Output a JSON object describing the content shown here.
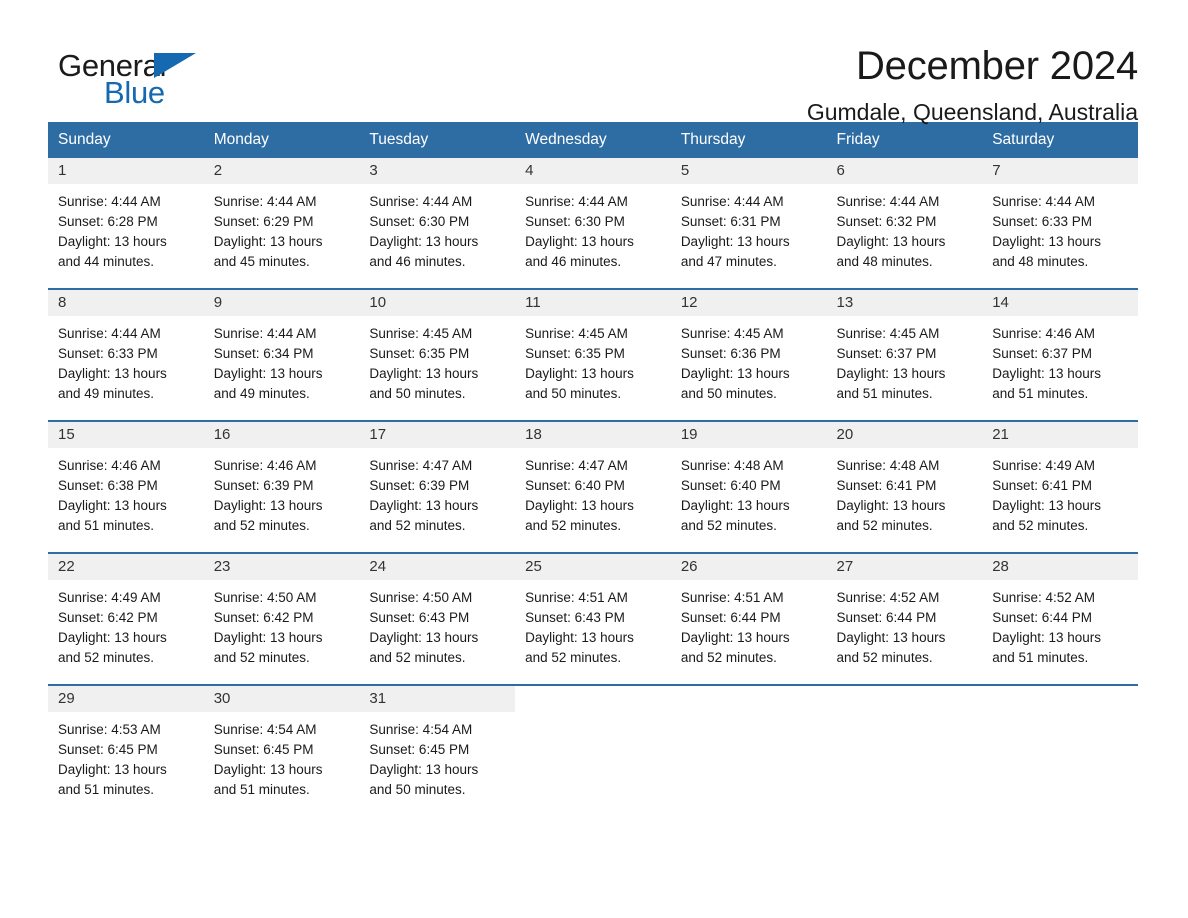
{
  "brand": {
    "name_part1": "General",
    "name_part2": "Blue",
    "accent_color": "#1569b0"
  },
  "header": {
    "title": "December 2024",
    "subtitle": "Gumdale, Queensland, Australia"
  },
  "theme": {
    "header_blue": "#2e6da4",
    "daynum_band": "#f0f0f0",
    "text": "#1a1a1a"
  },
  "calendar": {
    "weekdays": [
      "Sunday",
      "Monday",
      "Tuesday",
      "Wednesday",
      "Thursday",
      "Friday",
      "Saturday"
    ],
    "weeks": [
      [
        {
          "day": "1",
          "sunrise": "Sunrise: 4:44 AM",
          "sunset": "Sunset: 6:28 PM",
          "daylight1": "Daylight: 13 hours",
          "daylight2": "and 44 minutes."
        },
        {
          "day": "2",
          "sunrise": "Sunrise: 4:44 AM",
          "sunset": "Sunset: 6:29 PM",
          "daylight1": "Daylight: 13 hours",
          "daylight2": "and 45 minutes."
        },
        {
          "day": "3",
          "sunrise": "Sunrise: 4:44 AM",
          "sunset": "Sunset: 6:30 PM",
          "daylight1": "Daylight: 13 hours",
          "daylight2": "and 46 minutes."
        },
        {
          "day": "4",
          "sunrise": "Sunrise: 4:44 AM",
          "sunset": "Sunset: 6:30 PM",
          "daylight1": "Daylight: 13 hours",
          "daylight2": "and 46 minutes."
        },
        {
          "day": "5",
          "sunrise": "Sunrise: 4:44 AM",
          "sunset": "Sunset: 6:31 PM",
          "daylight1": "Daylight: 13 hours",
          "daylight2": "and 47 minutes."
        },
        {
          "day": "6",
          "sunrise": "Sunrise: 4:44 AM",
          "sunset": "Sunset: 6:32 PM",
          "daylight1": "Daylight: 13 hours",
          "daylight2": "and 48 minutes."
        },
        {
          "day": "7",
          "sunrise": "Sunrise: 4:44 AM",
          "sunset": "Sunset: 6:33 PM",
          "daylight1": "Daylight: 13 hours",
          "daylight2": "and 48 minutes."
        }
      ],
      [
        {
          "day": "8",
          "sunrise": "Sunrise: 4:44 AM",
          "sunset": "Sunset: 6:33 PM",
          "daylight1": "Daylight: 13 hours",
          "daylight2": "and 49 minutes."
        },
        {
          "day": "9",
          "sunrise": "Sunrise: 4:44 AM",
          "sunset": "Sunset: 6:34 PM",
          "daylight1": "Daylight: 13 hours",
          "daylight2": "and 49 minutes."
        },
        {
          "day": "10",
          "sunrise": "Sunrise: 4:45 AM",
          "sunset": "Sunset: 6:35 PM",
          "daylight1": "Daylight: 13 hours",
          "daylight2": "and 50 minutes."
        },
        {
          "day": "11",
          "sunrise": "Sunrise: 4:45 AM",
          "sunset": "Sunset: 6:35 PM",
          "daylight1": "Daylight: 13 hours",
          "daylight2": "and 50 minutes."
        },
        {
          "day": "12",
          "sunrise": "Sunrise: 4:45 AM",
          "sunset": "Sunset: 6:36 PM",
          "daylight1": "Daylight: 13 hours",
          "daylight2": "and 50 minutes."
        },
        {
          "day": "13",
          "sunrise": "Sunrise: 4:45 AM",
          "sunset": "Sunset: 6:37 PM",
          "daylight1": "Daylight: 13 hours",
          "daylight2": "and 51 minutes."
        },
        {
          "day": "14",
          "sunrise": "Sunrise: 4:46 AM",
          "sunset": "Sunset: 6:37 PM",
          "daylight1": "Daylight: 13 hours",
          "daylight2": "and 51 minutes."
        }
      ],
      [
        {
          "day": "15",
          "sunrise": "Sunrise: 4:46 AM",
          "sunset": "Sunset: 6:38 PM",
          "daylight1": "Daylight: 13 hours",
          "daylight2": "and 51 minutes."
        },
        {
          "day": "16",
          "sunrise": "Sunrise: 4:46 AM",
          "sunset": "Sunset: 6:39 PM",
          "daylight1": "Daylight: 13 hours",
          "daylight2": "and 52 minutes."
        },
        {
          "day": "17",
          "sunrise": "Sunrise: 4:47 AM",
          "sunset": "Sunset: 6:39 PM",
          "daylight1": "Daylight: 13 hours",
          "daylight2": "and 52 minutes."
        },
        {
          "day": "18",
          "sunrise": "Sunrise: 4:47 AM",
          "sunset": "Sunset: 6:40 PM",
          "daylight1": "Daylight: 13 hours",
          "daylight2": "and 52 minutes."
        },
        {
          "day": "19",
          "sunrise": "Sunrise: 4:48 AM",
          "sunset": "Sunset: 6:40 PM",
          "daylight1": "Daylight: 13 hours",
          "daylight2": "and 52 minutes."
        },
        {
          "day": "20",
          "sunrise": "Sunrise: 4:48 AM",
          "sunset": "Sunset: 6:41 PM",
          "daylight1": "Daylight: 13 hours",
          "daylight2": "and 52 minutes."
        },
        {
          "day": "21",
          "sunrise": "Sunrise: 4:49 AM",
          "sunset": "Sunset: 6:41 PM",
          "daylight1": "Daylight: 13 hours",
          "daylight2": "and 52 minutes."
        }
      ],
      [
        {
          "day": "22",
          "sunrise": "Sunrise: 4:49 AM",
          "sunset": "Sunset: 6:42 PM",
          "daylight1": "Daylight: 13 hours",
          "daylight2": "and 52 minutes."
        },
        {
          "day": "23",
          "sunrise": "Sunrise: 4:50 AM",
          "sunset": "Sunset: 6:42 PM",
          "daylight1": "Daylight: 13 hours",
          "daylight2": "and 52 minutes."
        },
        {
          "day": "24",
          "sunrise": "Sunrise: 4:50 AM",
          "sunset": "Sunset: 6:43 PM",
          "daylight1": "Daylight: 13 hours",
          "daylight2": "and 52 minutes."
        },
        {
          "day": "25",
          "sunrise": "Sunrise: 4:51 AM",
          "sunset": "Sunset: 6:43 PM",
          "daylight1": "Daylight: 13 hours",
          "daylight2": "and 52 minutes."
        },
        {
          "day": "26",
          "sunrise": "Sunrise: 4:51 AM",
          "sunset": "Sunset: 6:44 PM",
          "daylight1": "Daylight: 13 hours",
          "daylight2": "and 52 minutes."
        },
        {
          "day": "27",
          "sunrise": "Sunrise: 4:52 AM",
          "sunset": "Sunset: 6:44 PM",
          "daylight1": "Daylight: 13 hours",
          "daylight2": "and 52 minutes."
        },
        {
          "day": "28",
          "sunrise": "Sunrise: 4:52 AM",
          "sunset": "Sunset: 6:44 PM",
          "daylight1": "Daylight: 13 hours",
          "daylight2": "and 51 minutes."
        }
      ],
      [
        {
          "day": "29",
          "sunrise": "Sunrise: 4:53 AM",
          "sunset": "Sunset: 6:45 PM",
          "daylight1": "Daylight: 13 hours",
          "daylight2": "and 51 minutes."
        },
        {
          "day": "30",
          "sunrise": "Sunrise: 4:54 AM",
          "sunset": "Sunset: 6:45 PM",
          "daylight1": "Daylight: 13 hours",
          "daylight2": "and 51 minutes."
        },
        {
          "day": "31",
          "sunrise": "Sunrise: 4:54 AM",
          "sunset": "Sunset: 6:45 PM",
          "daylight1": "Daylight: 13 hours",
          "daylight2": "and 50 minutes."
        },
        {
          "day": "",
          "sunrise": "",
          "sunset": "",
          "daylight1": "",
          "daylight2": ""
        },
        {
          "day": "",
          "sunrise": "",
          "sunset": "",
          "daylight1": "",
          "daylight2": ""
        },
        {
          "day": "",
          "sunrise": "",
          "sunset": "",
          "daylight1": "",
          "daylight2": ""
        },
        {
          "day": "",
          "sunrise": "",
          "sunset": "",
          "daylight1": "",
          "daylight2": ""
        }
      ]
    ]
  }
}
